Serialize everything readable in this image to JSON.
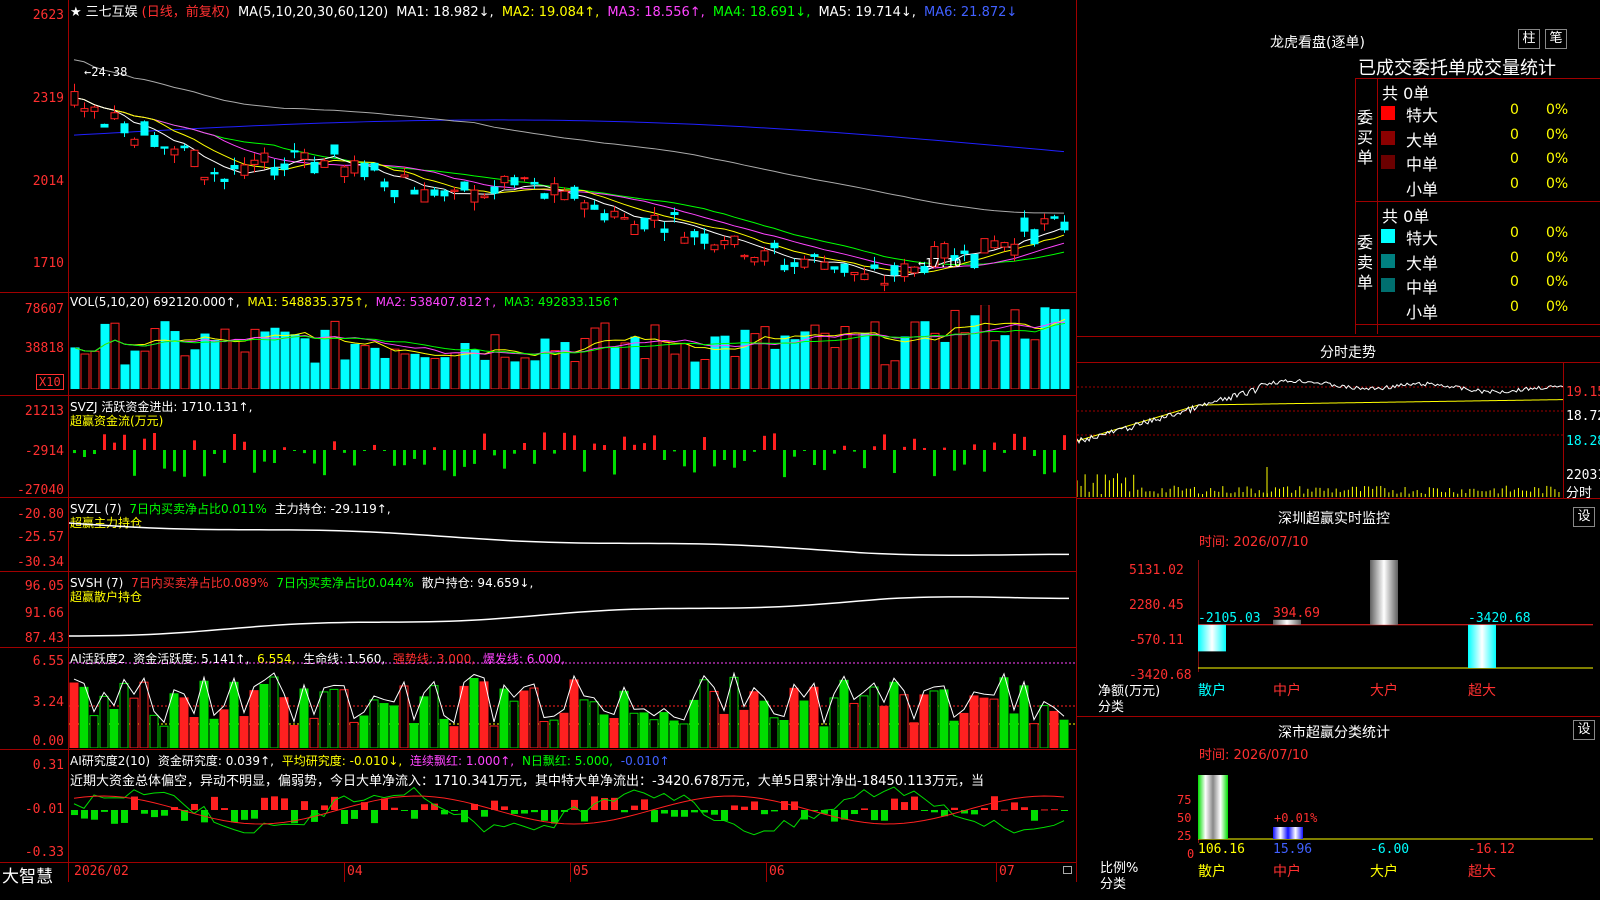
{
  "colors": {
    "up": "#ff2020",
    "down": "#00ffff",
    "grid": "#a00000",
    "ma1": "#ffffff",
    "ma2": "#ffff00",
    "ma3": "#ff44ff",
    "ma4": "#00ff00",
    "ma5": "#aaaaaa",
    "ma6": "#2020ff"
  },
  "stock": {
    "star": "★",
    "name": "三七互娱",
    "period": "(日线，前复权)"
  },
  "kline_header": {
    "ma_label": "MA(5,10,20,30,60,120)",
    "ma1": "MA1: 18.982↓,",
    "ma2": "MA2: 19.084↑,",
    "ma3": "MA3: 18.556↑,",
    "ma4": "MA4: 18.691↓,",
    "ma5": "MA5: 19.714↓,",
    "ma6": "MA6: 21.872↓"
  },
  "kline_axis": [
    "2623",
    "2319",
    "2014",
    "1710"
  ],
  "kline_annotations": {
    "high": "←24.38",
    "low": "←17.10"
  },
  "vol": {
    "header": "VOL(5,10,20) 692120.000↑,",
    "ma1": "MA1: 548835.375↑,",
    "ma2": "MA2: 538407.812↑,",
    "ma3": "MA3: 492833.156↑",
    "axis": [
      "78607",
      "38818"
    ],
    "unit": "X10"
  },
  "svzj": {
    "header": "SVZJ  活跃资金进出: 1710.131↑,",
    "sub": "超赢资金流(万元)",
    "axis": [
      "21213",
      "-2914",
      "-27040"
    ]
  },
  "svzl": {
    "name": "SVZL (7)",
    "a": "7日内买卖净占比0.011%",
    "b": "主力持仓: -29.119↑,",
    "sub": "超赢主力持仓",
    "axis": [
      "-20.80",
      "-25.57",
      "-30.34"
    ]
  },
  "svsh": {
    "name": "SVSH (7)",
    "a": "7日内买卖净占比0.089%",
    "b": "7日内买卖净占比0.044%",
    "c": "散户持仓: 94.659↓,",
    "sub": "超赢散户持仓",
    "axis": [
      "96.05",
      "91.66",
      "87.43"
    ]
  },
  "ai_active": {
    "name": "AI活跃度2",
    "a": "资金活跃度: 5.141↑,",
    "b": "6.554,",
    "c": "生命线: 1.560,",
    "d": "强势线: 3.000,",
    "e": "爆发线: 6.000,",
    "axis": [
      "6.55",
      "3.24",
      "0.00"
    ]
  },
  "ai_research": {
    "name": "AI研究度2(10)",
    "a": "资金研究度: 0.039↑,",
    "b": "平均研究度: -0.010↓,",
    "c": "连续飘红: 1.000↑,",
    "d": "N日飘红: 5.000,",
    "e": "-0.010↑",
    "comment": "近期大资金总体偏空，异动不明显，偏弱势，今日大单净流入：1710.341万元，其中特大单净流出：-3420.678万元，大单5日累计净出-18450.113万元，当",
    "axis": [
      "0.31",
      "-0.01",
      "-0.33"
    ]
  },
  "bottom": {
    "brand": "大智慧",
    "dates": [
      "2026/02",
      "04",
      "05",
      "06",
      "07"
    ]
  },
  "longhu": {
    "title": "龙虎看盘(逐单)",
    "btn1": "柱",
    "btn2": "笔",
    "subtitle": "已成交委托单成交量统计",
    "buy_label": "委买单",
    "sell_label": "委卖单",
    "buy_total": "共 0单",
    "sell_total": "共 0单",
    "buy_rows": [
      {
        "label": "特大",
        "v": "0",
        "p": "0%",
        "c": "#ff0000"
      },
      {
        "label": "大单",
        "v": "0",
        "p": "0%",
        "c": "#8b0000"
      },
      {
        "label": "中单",
        "v": "0",
        "p": "0%",
        "c": "#6b0000"
      },
      {
        "label": "小单",
        "v": "0",
        "p": "0%",
        "c": "#000000"
      }
    ],
    "sell_rows": [
      {
        "label": "特大",
        "v": "0",
        "p": "0%",
        "c": "#00ffff"
      },
      {
        "label": "大单",
        "v": "0",
        "p": "0%",
        "c": "#008080"
      },
      {
        "label": "中单",
        "v": "0",
        "p": "0%",
        "c": "#006f6f"
      },
      {
        "label": "小单",
        "v": "0",
        "p": "0%",
        "c": "#000000"
      }
    ]
  },
  "intraday": {
    "title": "分时走势",
    "axis": [
      "19.15",
      "18.72",
      "18.28"
    ],
    "vol": "22031",
    "unit": "分时"
  },
  "monitor": {
    "title": "深圳超赢实时监控",
    "btn": "设",
    "time": "时间: 2026/07/10",
    "axis": [
      "5131.02",
      "2280.45",
      "-570.11",
      "-3420.68"
    ],
    "ylabel": "净额(万元)",
    "xlabel": "分类",
    "bars": [
      {
        "cat": "散户",
        "value": -2105.03,
        "label": "-2105.03"
      },
      {
        "cat": "中户",
        "value": 394.69,
        "label": "394.69"
      },
      {
        "cat": "大户",
        "value": 5131.02,
        "label": "5131.02"
      },
      {
        "cat": "超大",
        "value": -3420.68,
        "label": "-3420.68"
      }
    ]
  },
  "stats": {
    "title": "深市超赢分类统计",
    "btn": "设",
    "time": "时间: 2026/07/10",
    "axis": [
      "75",
      "50",
      "25",
      "0"
    ],
    "ylabel": "比例%",
    "xlabel": "分类",
    "bar_label": "+0.01%",
    "bars": [
      {
        "cat": "散户",
        "value": "106.16"
      },
      {
        "cat": "中户",
        "value": "15.96"
      },
      {
        "cat": "大户",
        "value": "-6.00"
      },
      {
        "cat": "超大",
        "value": "-16.12"
      }
    ]
  }
}
